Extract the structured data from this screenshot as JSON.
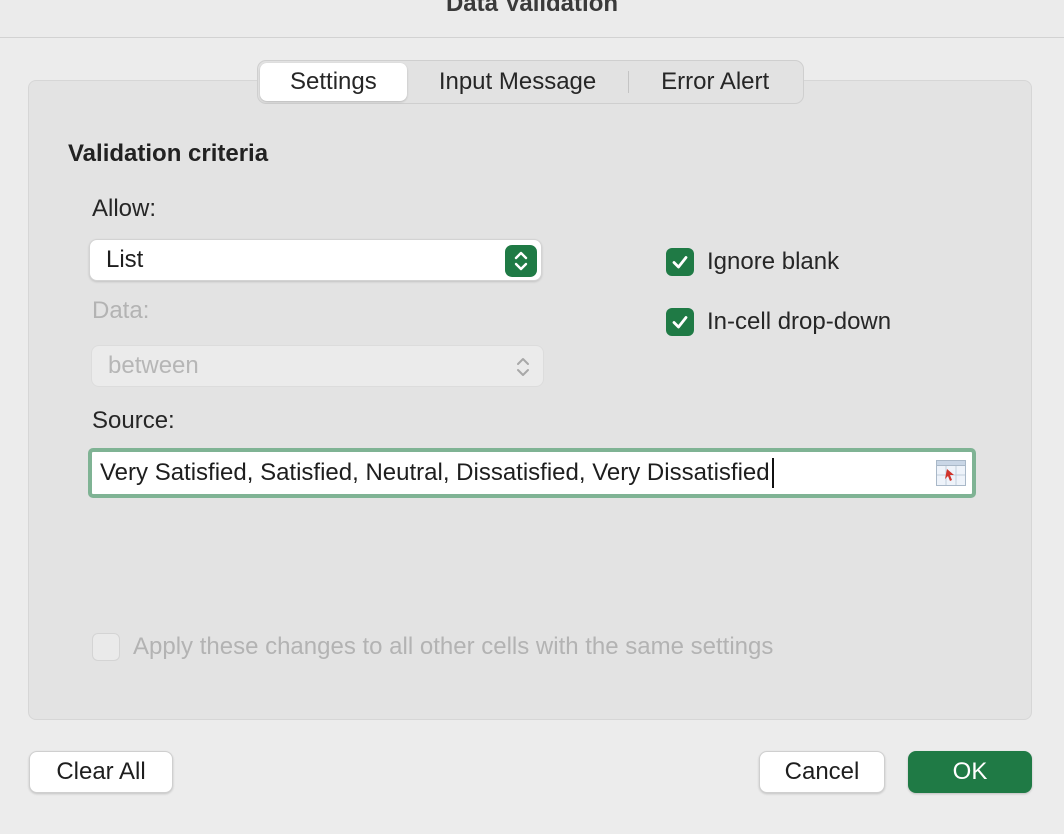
{
  "window": {
    "title": "Data Validation"
  },
  "tabs": [
    {
      "label": "Settings",
      "selected": true
    },
    {
      "label": "Input Message",
      "selected": false
    },
    {
      "label": "Error Alert",
      "selected": false
    }
  ],
  "criteria": {
    "heading": "Validation criteria",
    "allow_label": "Allow:",
    "allow_value": "List",
    "data_label": "Data:",
    "data_value": "between",
    "data_enabled": false,
    "source_label": "Source:",
    "source_value": "Very Satisfied, Satisfied, Neutral, Dissatisfied, Very Dissatisfied"
  },
  "options": {
    "ignore_blank": {
      "label": "Ignore blank",
      "checked": true
    },
    "in_cell_dropdown": {
      "label": "In-cell drop-down",
      "checked": true
    },
    "apply_all": {
      "label": "Apply these changes to all other cells with the same settings",
      "checked": false,
      "enabled": false
    }
  },
  "buttons": {
    "clear_all": "Clear All",
    "cancel": "Cancel",
    "ok": "OK"
  },
  "icons": {
    "allow_stepper": "chevron-up-down-icon",
    "data_stepper": "chevron-up-down-icon",
    "range_picker": "range-selector-icon",
    "checkmark": "checkmark-icon"
  },
  "colors": {
    "accent": "#1f7a45",
    "focus_ring": "#7fb394",
    "disabled_text": "#b3b3b3"
  }
}
